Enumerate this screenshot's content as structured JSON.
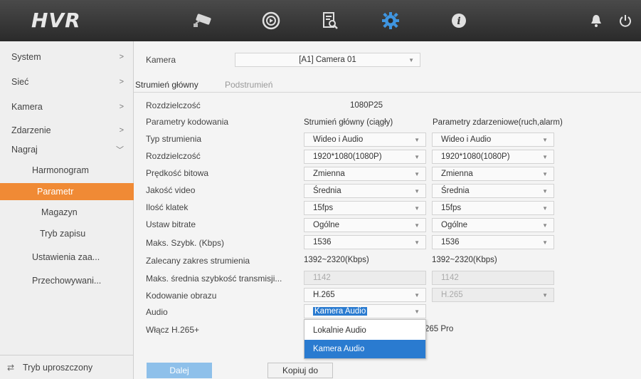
{
  "app": {
    "logo": "HVR"
  },
  "topnav": {
    "icons": [
      "camera-icon",
      "playback-icon",
      "search-icon",
      "settings-icon",
      "info-icon",
      "alarm-icon",
      "power-icon"
    ]
  },
  "sidebar": {
    "items": [
      {
        "label": "System",
        "arrow": ">"
      },
      {
        "label": "Sieć",
        "arrow": ">"
      },
      {
        "label": "Kamera",
        "arrow": ">"
      },
      {
        "label": "Zdarzenie",
        "arrow": ">"
      },
      {
        "label": "Nagraj",
        "arrow": "﹀"
      }
    ],
    "subitems": [
      {
        "label": "Harmonogram"
      },
      {
        "label": "Parametr"
      },
      {
        "label": "Magazyn"
      },
      {
        "label": "Tryb zapisu"
      },
      {
        "label": "Ustawienia zaa..."
      },
      {
        "label": "Przechowywani..."
      }
    ],
    "footer": "Tryb uproszczony"
  },
  "main": {
    "camera_label": "Kamera",
    "camera_value": "[A1] Camera 01",
    "tabs": [
      {
        "label": "Strumień główny"
      },
      {
        "label": "Podstrumień"
      }
    ],
    "resolution_top_label": "Rozdzielczość",
    "resolution_top_value": "1080P25",
    "encoding_label": "Parametry kodowania",
    "col1_header": "Strumień główny (ciągły)",
    "col2_header": "Parametry zdarzeniowe(ruch,alarm)",
    "rows": [
      {
        "label": "Typ strumienia",
        "v1": "Wideo i Audio",
        "v2": "Wideo i Audio"
      },
      {
        "label": "Rozdzielczość",
        "v1": "1920*1080(1080P)",
        "v2": "1920*1080(1080P)"
      },
      {
        "label": "Prędkość bitowa",
        "v1": "Zmienna",
        "v2": "Zmienna"
      },
      {
        "label": "Jakość video",
        "v1": "Średnia",
        "v2": "Średnia"
      },
      {
        "label": "Ilość klatek",
        "v1": "15fps",
        "v2": "15fps"
      },
      {
        "label": "Ustaw bitrate",
        "v1": "Ogólne",
        "v2": "Ogólne"
      },
      {
        "label": "Maks. Szybk. (Kbps)",
        "v1": "1536",
        "v2": "1536"
      }
    ],
    "recommended_label": "Zalecany zakres strumienia",
    "recommended_v1": "1392~2320(Kbps)",
    "recommended_v2": "1392~2320(Kbps)",
    "max_avg_label": "Maks. średnia szybkość transmisji...",
    "max_avg_v1": "1142",
    "max_avg_v2": "1142",
    "codec_label": "Kodowanie obrazu",
    "codec_v1": "H.265",
    "codec_v2": "H.265",
    "audio_label": "Audio",
    "audio_value": "Kamera Audio",
    "h265_label": "Włącz H.265+",
    "h265_value_partial": "265 Pro",
    "audio_options": [
      "Lokalnie Audio",
      "Kamera Audio"
    ]
  },
  "buttons": {
    "next": "Dalej",
    "copy": "Kopiuj do"
  },
  "colors": {
    "accent": "#f08a35",
    "selection": "#2a7bd0",
    "topbar": "#333333"
  }
}
